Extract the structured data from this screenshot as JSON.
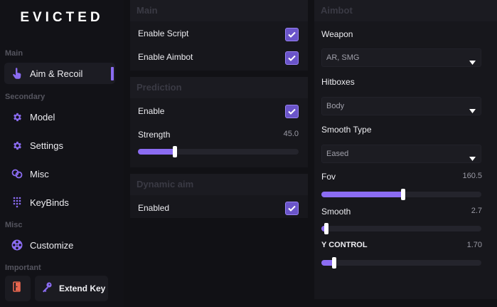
{
  "app": {
    "title": "EVICTED"
  },
  "sidebar": {
    "sections": {
      "main": "Main",
      "secondary": "Secondary",
      "misc": "Misc",
      "important": "Important"
    },
    "items": [
      {
        "label": "Aim & Recoil",
        "icon": "pointer-hand-icon",
        "active": true
      },
      {
        "label": "Model",
        "icon": "gear-icon",
        "active": false
      },
      {
        "label": "Settings",
        "icon": "gear-icon",
        "active": false
      },
      {
        "label": "Misc",
        "icon": "link-icon",
        "active": false
      },
      {
        "label": "KeyBinds",
        "icon": "keypad-icon",
        "active": false
      },
      {
        "label": "Customize",
        "icon": "film-reel-icon",
        "active": false
      }
    ],
    "exit_icon": "exit-door-icon",
    "extend_key": {
      "label": "Extend Key",
      "icon": "key-icon"
    }
  },
  "main_panel": {
    "title": "Main",
    "rows": [
      {
        "label": "Enable Script",
        "checked": true
      },
      {
        "label": "Enable Aimbot",
        "checked": true
      }
    ]
  },
  "prediction_panel": {
    "title": "Prediction",
    "enable": {
      "label": "Enable",
      "checked": true
    },
    "strength": {
      "label": "Strength",
      "value": "45.0",
      "fraction": 0.23
    }
  },
  "dynamic_panel": {
    "title": "Dynamic aim",
    "enabled": {
      "label": "Enabled",
      "checked": true
    }
  },
  "aimbot_panel": {
    "title": "Aimbot",
    "weapon": {
      "label": "Weapon",
      "selected": "AR, SMG"
    },
    "hitboxes": {
      "label": "Hitboxes",
      "selected": "Body"
    },
    "smooth_type": {
      "label": "Smooth Type",
      "selected": "Eased"
    },
    "fov": {
      "label": "Fov",
      "value": "160.5",
      "fraction": 0.51
    },
    "smooth": {
      "label": "Smooth",
      "value": "2.7",
      "fraction": 0.03
    },
    "y_control": {
      "label": "Y CONTROL",
      "value": "1.70",
      "fraction": 0.08
    }
  },
  "colors": {
    "accent": "#8b6cf2",
    "background": "#111115",
    "panel": "#17171c"
  }
}
